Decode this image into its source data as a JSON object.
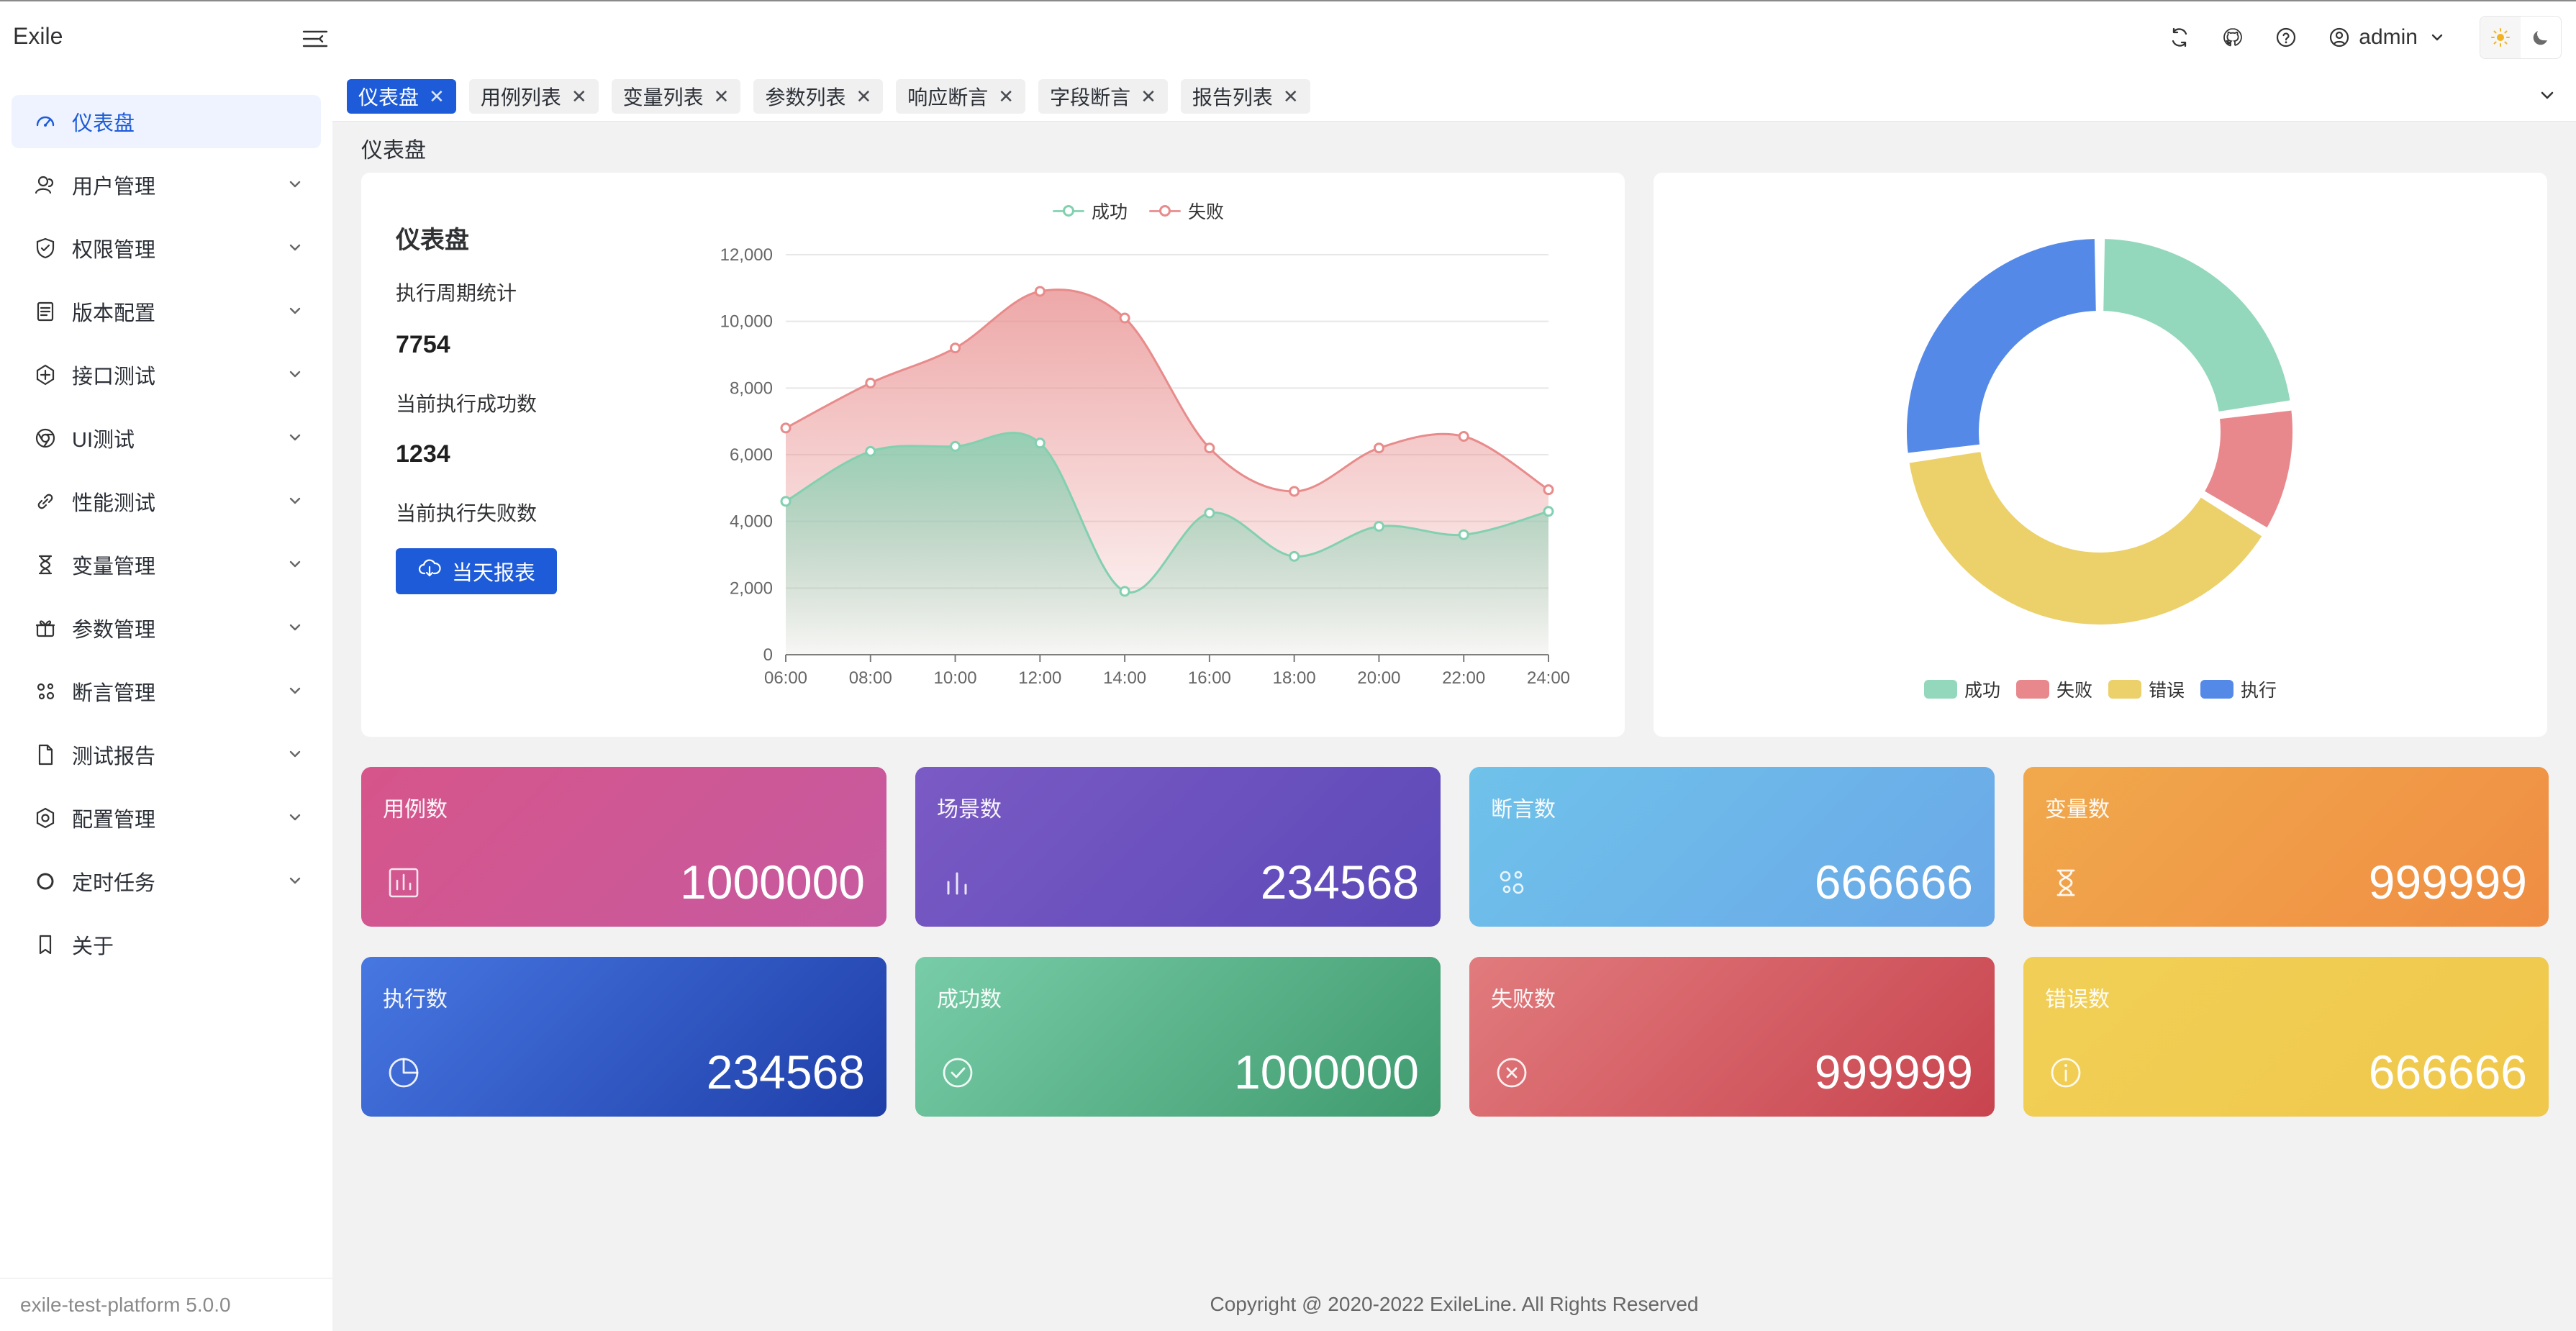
{
  "app": {
    "brand": "Exile",
    "user": "admin",
    "version": "exile-test-platform 5.0.0"
  },
  "sidebar": {
    "items": [
      {
        "label": "仪表盘",
        "icon": "dashboard-icon",
        "active": true,
        "has_children": false
      },
      {
        "label": "用户管理",
        "icon": "users-icon",
        "has_children": true
      },
      {
        "label": "权限管理",
        "icon": "shield-icon",
        "has_children": true
      },
      {
        "label": "版本配置",
        "icon": "document-icon",
        "has_children": true
      },
      {
        "label": "接口测试",
        "icon": "api-icon",
        "has_children": true
      },
      {
        "label": "UI测试",
        "icon": "chrome-icon",
        "has_children": true
      },
      {
        "label": "性能测试",
        "icon": "link-icon",
        "has_children": true
      },
      {
        "label": "变量管理",
        "icon": "hourglass-icon",
        "has_children": true
      },
      {
        "label": "参数管理",
        "icon": "gift-icon",
        "has_children": true
      },
      {
        "label": "断言管理",
        "icon": "nodes-icon",
        "has_children": true
      },
      {
        "label": "测试报告",
        "icon": "file-icon",
        "has_children": true
      },
      {
        "label": "配置管理",
        "icon": "settings-icon",
        "has_children": true
      },
      {
        "label": "定时任务",
        "icon": "circle-icon",
        "has_children": true
      },
      {
        "label": "关于",
        "icon": "bookmark-icon",
        "has_children": false
      }
    ]
  },
  "tabs": [
    {
      "label": "仪表盘",
      "active": true
    },
    {
      "label": "用例列表"
    },
    {
      "label": "变量列表"
    },
    {
      "label": "参数列表"
    },
    {
      "label": "响应断言"
    },
    {
      "label": "字段断言"
    },
    {
      "label": "报告列表"
    }
  ],
  "page": {
    "title": "仪表盘"
  },
  "stats": {
    "title": "仪表盘",
    "period_label": "执行周期统计",
    "period_value": "7754",
    "success_label": "当前执行成功数",
    "success_value": "1234",
    "fail_label": "当前执行失败数",
    "report_button": "当天报表"
  },
  "chart_data": [
    {
      "type": "area",
      "legend": [
        "成功",
        "失败"
      ],
      "x": [
        "06:00",
        "08:00",
        "10:00",
        "12:00",
        "14:00",
        "16:00",
        "18:00",
        "20:00",
        "22:00",
        "24:00"
      ],
      "ylim": [
        0,
        12000
      ],
      "yticks": [
        0,
        2000,
        4000,
        6000,
        8000,
        10000,
        12000
      ],
      "ytick_labels": [
        "0",
        "2,000",
        "4,000",
        "6,000",
        "8,000",
        "10,000",
        "12,000"
      ],
      "series": [
        {
          "name": "成功",
          "values": [
            4600,
            6100,
            6250,
            6350,
            1900,
            4250,
            2950,
            3850,
            3600,
            4300
          ],
          "color": "#83d0b0"
        },
        {
          "name": "失败",
          "values": [
            6800,
            8150,
            9200,
            10900,
            10100,
            6200,
            4900,
            6200,
            6550,
            4950
          ],
          "color": "#e88b8b"
        }
      ],
      "grid": true,
      "legend_position": "top"
    },
    {
      "type": "pie",
      "legend": [
        "成功",
        "失败",
        "错误",
        "执行"
      ],
      "values": [
        21,
        10,
        36,
        25
      ],
      "colors": [
        "#93d8bc",
        "#e8888d",
        "#ecd06a",
        "#5489e8"
      ],
      "legend_position": "bottom"
    }
  ],
  "tiles": [
    {
      "label": "用例数",
      "value": "1000000",
      "icon": "bar-chart-icon",
      "from": "#d6558a",
      "to": "#c65aa0"
    },
    {
      "label": "场景数",
      "value": "234568",
      "icon": "bars-icon",
      "from": "#7b5ac4",
      "to": "#5b49b8"
    },
    {
      "label": "断言数",
      "value": "666666",
      "icon": "nodes-icon",
      "from": "#6fc2ea",
      "to": "#6aa8e8"
    },
    {
      "label": "变量数",
      "value": "999999",
      "icon": "hourglass-icon",
      "from": "#f1a94c",
      "to": "#ef8d43"
    },
    {
      "label": "执行数",
      "value": "234568",
      "icon": "pie-icon",
      "from": "#4777e2",
      "to": "#1f3ea8"
    },
    {
      "label": "成功数",
      "value": "1000000",
      "icon": "check-circle-icon",
      "from": "#78cda8",
      "to": "#3f9a6e"
    },
    {
      "label": "失败数",
      "value": "999999",
      "icon": "close-circle-icon",
      "from": "#e17b7d",
      "to": "#c8444f"
    },
    {
      "label": "错误数",
      "value": "666666",
      "icon": "info-circle-icon",
      "from": "#f1cf56",
      "to": "#f0c84b"
    }
  ],
  "footer": {
    "copyright": "Copyright @ 2020-2022 ExileLine. All Rights Reserved"
  },
  "colors": {
    "primary": "#1d5bd8",
    "success": "#83d0b0",
    "fail": "#e88b8b"
  }
}
